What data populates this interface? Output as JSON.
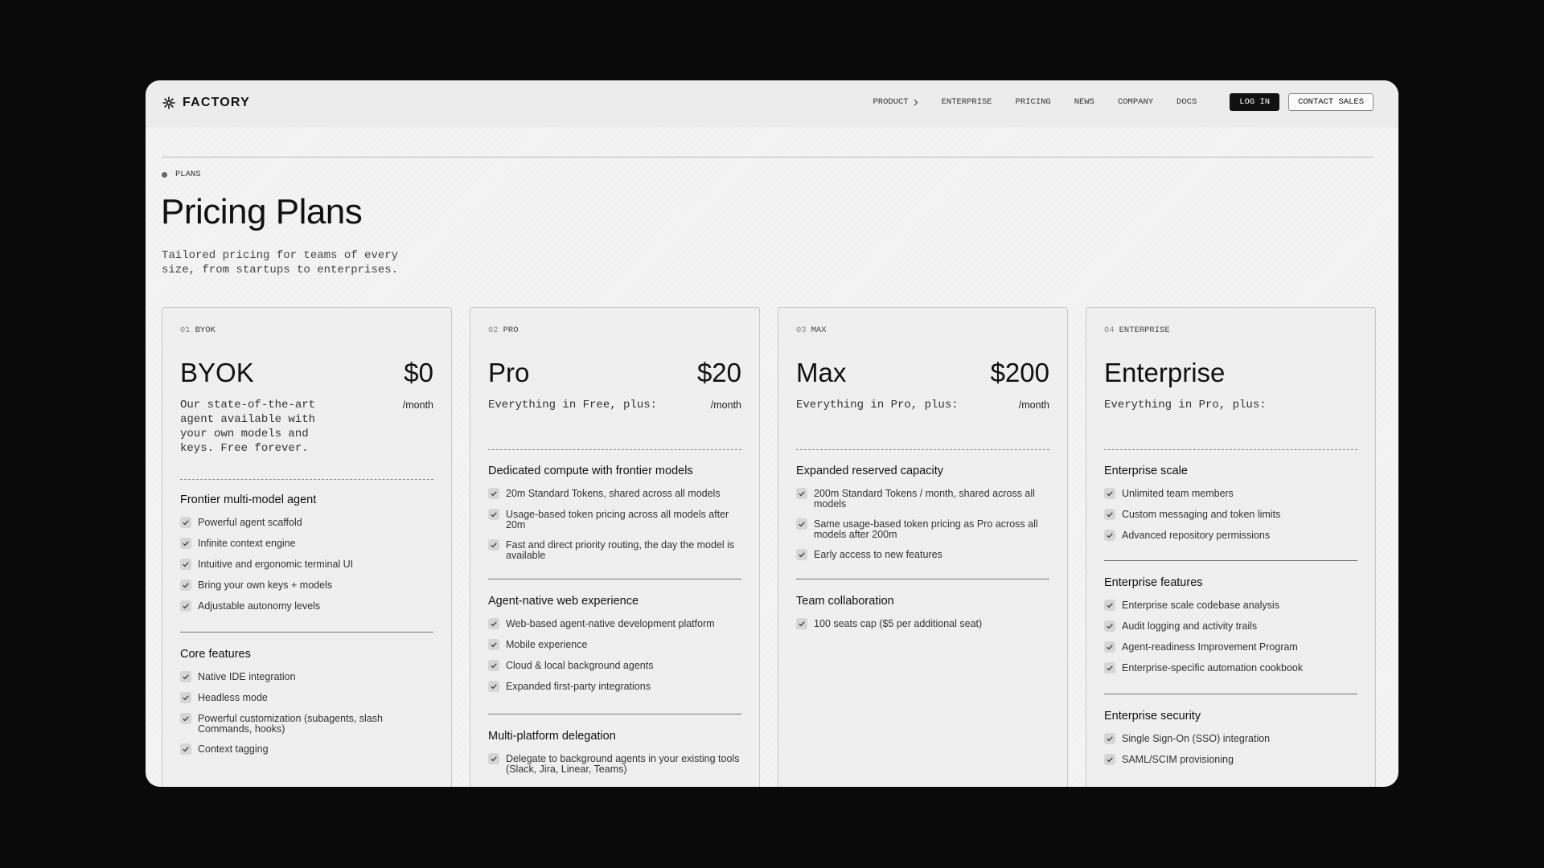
{
  "brand": {
    "name": "FACTORY",
    "logo_icon": "asterisk-flower-icon"
  },
  "nav": {
    "links": [
      "PRODUCT",
      "ENTERPRISE",
      "PRICING",
      "NEWS",
      "COMPANY",
      "DOCS"
    ],
    "login": "LOG IN",
    "contact": "CONTACT SALES"
  },
  "header": {
    "crumb": "PLANS",
    "title": "Pricing Plans",
    "subtitle": "Tailored pricing for teams of every size, from startups to enterprises."
  },
  "plans": [
    {
      "num": "01",
      "tag": "BYOK",
      "name": "BYOK",
      "price": "$0",
      "period": "/month",
      "desc": "Our state-of-the-art agent available with your own models and keys. Free forever.",
      "sections": [
        {
          "title": "Frontier multi-model agent",
          "features": [
            "Powerful agent scaffold",
            "Infinite context engine",
            "Intuitive and ergonomic terminal UI",
            "Bring your own keys + models",
            "Adjustable autonomy levels"
          ]
        },
        {
          "title": "Core features",
          "features": [
            "Native IDE integration",
            "Headless mode",
            "Powerful customization (subagents, slash Commands, hooks)",
            "Context tagging"
          ]
        }
      ]
    },
    {
      "num": "02",
      "tag": "PRO",
      "name": "Pro",
      "price": "$20",
      "period": "/month",
      "desc": "Everything in Free, plus:",
      "sections": [
        {
          "title": "Dedicated compute with frontier models",
          "features": [
            "20m Standard Tokens, shared across all models",
            "Usage-based token pricing across all models after 20m",
            "Fast and direct priority routing, the day the model is available"
          ]
        },
        {
          "title": "Agent-native web experience",
          "features": [
            "Web-based agent-native development platform",
            "Mobile experience",
            "Cloud & local background agents",
            "Expanded first-party integrations"
          ]
        },
        {
          "title": "Multi-platform delegation",
          "features": [
            "Delegate to background agents in your existing tools (Slack, Jira, Linear, Teams)"
          ]
        }
      ]
    },
    {
      "num": "03",
      "tag": "MAX",
      "name": "Max",
      "price": "$200",
      "period": "/month",
      "desc": "Everything in Pro, plus:",
      "sections": [
        {
          "title": "Expanded reserved capacity",
          "features": [
            "200m Standard Tokens / month, shared across all models",
            "Same usage-based token pricing as Pro across all models after 200m",
            "Early access to new features"
          ]
        },
        {
          "title": "Team collaboration",
          "features": [
            "100 seats cap ($5 per additional seat)"
          ]
        }
      ]
    },
    {
      "num": "04",
      "tag": "ENTERPRISE",
      "name": "Enterprise",
      "price": "",
      "period": "",
      "desc": "Everything in Pro, plus:",
      "sections": [
        {
          "title": "Enterprise scale",
          "features": [
            "Unlimited team members",
            "Custom messaging and token limits",
            "Advanced repository permissions"
          ]
        },
        {
          "title": "Enterprise features",
          "features": [
            "Enterprise scale codebase analysis",
            "Audit logging and activity trails",
            "Agent-readiness Improvement Program",
            "Enterprise-specific automation cookbook"
          ]
        },
        {
          "title": "Enterprise security",
          "features": [
            "Single Sign-On (SSO) integration",
            "SAML/SCIM provisioning"
          ]
        }
      ]
    }
  ]
}
